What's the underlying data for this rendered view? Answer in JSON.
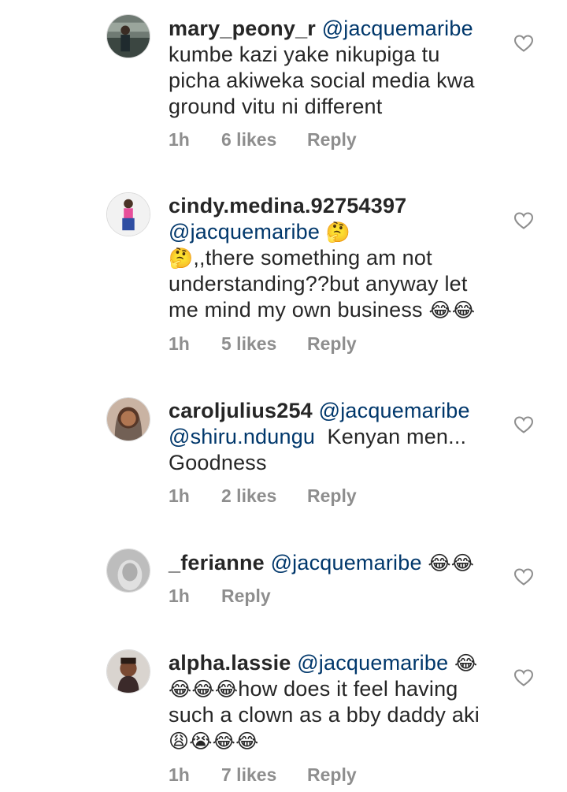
{
  "comments": [
    {
      "username": "mary_peony_r",
      "mention": "@jacquemaribe",
      "line2": "kumbe kazi yake nikupiga tu",
      "line3": "picha akiweka social media kwa",
      "line4": "ground vitu ni different",
      "time": "1h",
      "likes": "6 likes",
      "reply": "Reply"
    },
    {
      "username": "cindy.medina.92754397",
      "mention": "@jacquemaribe",
      "emoji_a": "🤔",
      "emoji_b": "🤔",
      "line3": ",,there something am not",
      "line4": "understanding??but anyway let",
      "line5": "me mind my own business",
      "emoji_c": "😂😂",
      "time": "1h",
      "likes": "5 likes",
      "reply": "Reply"
    },
    {
      "username": "caroljulius254",
      "mention": "@jacquemaribe",
      "mention2": "@shiru.ndungu",
      "line2_rest": "Kenyan men...",
      "line3": "Goodness",
      "time": "1h",
      "likes": "2 likes",
      "reply": "Reply"
    },
    {
      "username": "_ferianne",
      "mention": "@jacquemaribe",
      "emoji_a": "😂😂",
      "time": "1h",
      "reply": "Reply"
    },
    {
      "username": "alpha.lassie",
      "mention": "@jacquemaribe",
      "emoji_a": "😂",
      "emoji_b": "😂😂😂",
      "line2_rest": "how does it feel having",
      "line3": "such a clown as a bby daddy aki",
      "emoji_c": "😩😭😂😂",
      "time": "1h",
      "likes": "7 likes",
      "reply": "Reply"
    }
  ],
  "colors": {
    "text": "#262626",
    "mention": "#00376b",
    "meta": "#8e8e8e"
  },
  "icons": {
    "like": "heart-outline-icon"
  }
}
